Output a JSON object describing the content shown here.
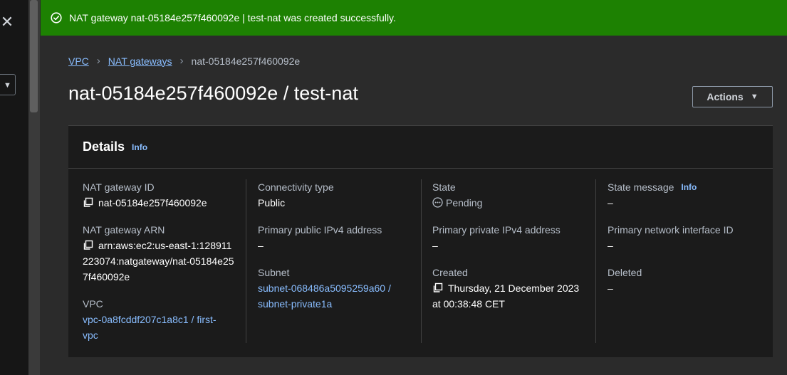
{
  "flash": {
    "message": "NAT gateway nat-05184e257f460092e | test-nat was created successfully.",
    "icon": "check-circle-icon",
    "color": "#1d8102"
  },
  "left_panel": {
    "close_glyph": "✕",
    "select_caret": "▼"
  },
  "breadcrumb": {
    "items": [
      "VPC",
      "NAT gateways"
    ],
    "current": "nat-05184e257f460092e",
    "separator": "›"
  },
  "page": {
    "title": "nat-05184e257f460092e / test-nat",
    "actions_label": "Actions",
    "actions_caret": "▼"
  },
  "details": {
    "title": "Details",
    "info_label": "Info",
    "columns": [
      {
        "fields": [
          {
            "label": "NAT gateway ID",
            "value": "nat-05184e257f460092e"
          },
          {
            "label": "NAT gateway ARN",
            "value": "arn:aws:ec2:us-east-1:128911223074:natgateway/nat-05184e257f460092e"
          },
          {
            "label": "VPC",
            "value": "vpc-0a8fcddf207c1a8c1 / first-vpc"
          }
        ]
      },
      {
        "fields": [
          {
            "label": "Connectivity type",
            "value": "Public"
          },
          {
            "label": "Primary public IPv4 address",
            "value": "–"
          },
          {
            "label": "Subnet",
            "value": "subnet-068486a5095259a60 / subnet-private1a"
          }
        ]
      },
      {
        "fields": [
          {
            "label": "State",
            "value": "Pending"
          },
          {
            "label": "Primary private IPv4 address",
            "value": "–"
          },
          {
            "label": "Created",
            "value": "Thursday, 21 December 2023 at 00:38:48 CET"
          }
        ]
      },
      {
        "fields": [
          {
            "label": "State message",
            "value": "–",
            "info_label": "Info"
          },
          {
            "label": "Primary network interface ID",
            "value": "–"
          },
          {
            "label": "Deleted",
            "value": "–"
          }
        ]
      }
    ]
  }
}
